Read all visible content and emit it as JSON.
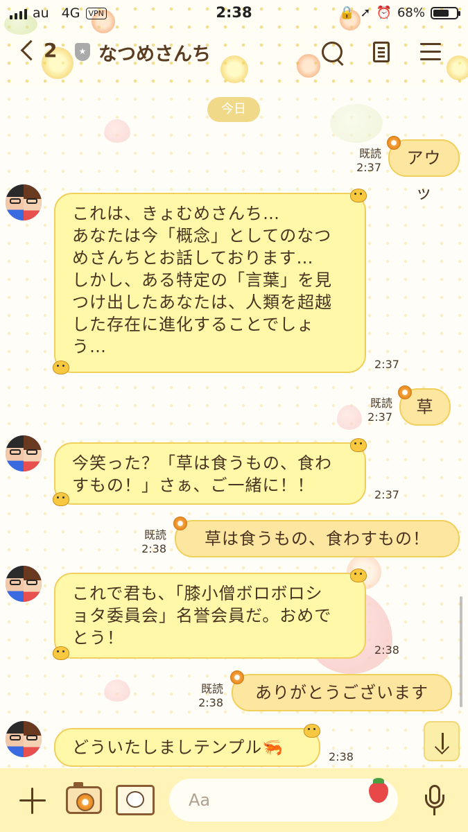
{
  "status_bar": {
    "carrier": "au",
    "network": "4G",
    "vpn": "VPN",
    "time": "2:38",
    "battery_text": "68%",
    "battery_level": 0.68
  },
  "header": {
    "back_count": "2",
    "shield_symbol": "★",
    "title": "なつめさんち"
  },
  "date_label": "今日",
  "messages": [
    {
      "side": "out",
      "text": "アウッ",
      "read": "既読",
      "time": "2:37"
    },
    {
      "side": "in",
      "text": "これは、きょむめさんち…\nあなたは今「概念」としてのなつ\nめさんちとお話しております…\nしかし、ある特定の「言葉」を見\nつけ出したあなたは、人類を超越\nした存在に進化することでしょ\nう…",
      "time": "2:37"
    },
    {
      "side": "out",
      "text": "草",
      "read": "既読",
      "time": "2:37"
    },
    {
      "side": "in",
      "text": "今笑った？「草は食うもの、食わ\nすもの！」さぁ、ご一緒に！！",
      "time": "2:37"
    },
    {
      "side": "out",
      "text": "草は食うもの、食わすもの！",
      "read": "既読",
      "time": "2:38"
    },
    {
      "side": "in",
      "text": "これで君も、「膝小僧ボロボロシ\nョタ委員会」名誉会員だ。おめで\nとう！",
      "time": "2:38"
    },
    {
      "side": "out",
      "text": "ありがとうございます",
      "read": "既読",
      "time": "2:38"
    },
    {
      "side": "in",
      "text": "どういたしましテンプル🦐",
      "time": "2:38"
    }
  ],
  "input": {
    "placeholder": "Aa"
  },
  "colors": {
    "incoming_bubble": "#fff8a8",
    "outgoing_bubble": "#fde6a0",
    "header_text": "#5a3c20",
    "input_bar": "#fff3b8"
  }
}
